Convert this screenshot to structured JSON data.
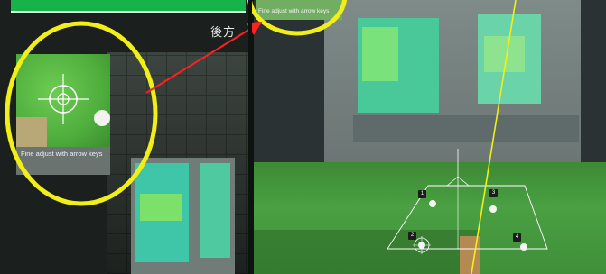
{
  "left_panel": {
    "rear_label": "後方",
    "fine_adjust_caption": "Fine adjust with arrow keys"
  },
  "right_panel": {
    "zoom_caption": "Fine adjust with arrow keys",
    "zone_numbers": [
      "1",
      "2",
      "3",
      "4"
    ]
  },
  "colors": {
    "highlight_circle": "#ffff00",
    "arrow": "#ff0000",
    "top_bar": "#17b24a"
  },
  "icons": {
    "crosshair": "crosshair-icon"
  }
}
